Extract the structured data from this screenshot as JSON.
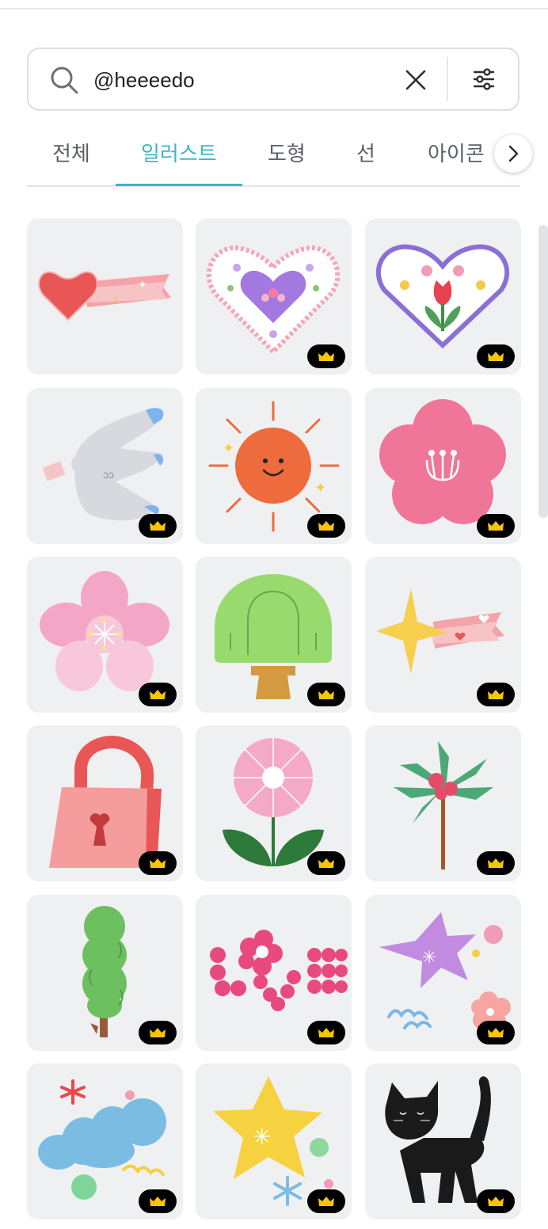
{
  "search": {
    "value": "@heeeedo"
  },
  "tabs": [
    {
      "label": "전체"
    },
    {
      "label": "일러스트"
    },
    {
      "label": "도형"
    },
    {
      "label": "선"
    },
    {
      "label": "아이콘"
    }
  ],
  "active_tab": "일러스트",
  "colors": {
    "accent": "#3fb4c9",
    "card_bg": "#eff0f2",
    "badge_bg": "#000000",
    "crown": "#f7c600"
  },
  "results": [
    {
      "icon": "heart-shooting-star-illustration",
      "premium": false
    },
    {
      "icon": "floral-heart-purple-illustration",
      "premium": true
    },
    {
      "icon": "tulip-heart-frame-illustration",
      "premium": true
    },
    {
      "icon": "dove-with-letter-illustration",
      "premium": true
    },
    {
      "icon": "smiling-sun-illustration",
      "premium": true
    },
    {
      "icon": "plum-blossom-illustration",
      "premium": true
    },
    {
      "icon": "cherry-blossom-illustration",
      "premium": true
    },
    {
      "icon": "green-tree-illustration",
      "premium": true
    },
    {
      "icon": "shooting-star-illustration",
      "premium": true
    },
    {
      "icon": "heart-padlock-illustration",
      "premium": true
    },
    {
      "icon": "pink-flower-leaves-illustration",
      "premium": true
    },
    {
      "icon": "palm-tree-illustration",
      "premium": true
    },
    {
      "icon": "cypress-tree-illustration",
      "premium": true
    },
    {
      "icon": "love-lettering-illustration",
      "premium": true
    },
    {
      "icon": "purple-star-burst-illustration",
      "premium": true
    },
    {
      "icon": "blue-cloud-shapes-illustration",
      "premium": true
    },
    {
      "icon": "yellow-star-sparkle-illustration",
      "premium": true
    },
    {
      "icon": "black-cat-illustration",
      "premium": true
    }
  ]
}
